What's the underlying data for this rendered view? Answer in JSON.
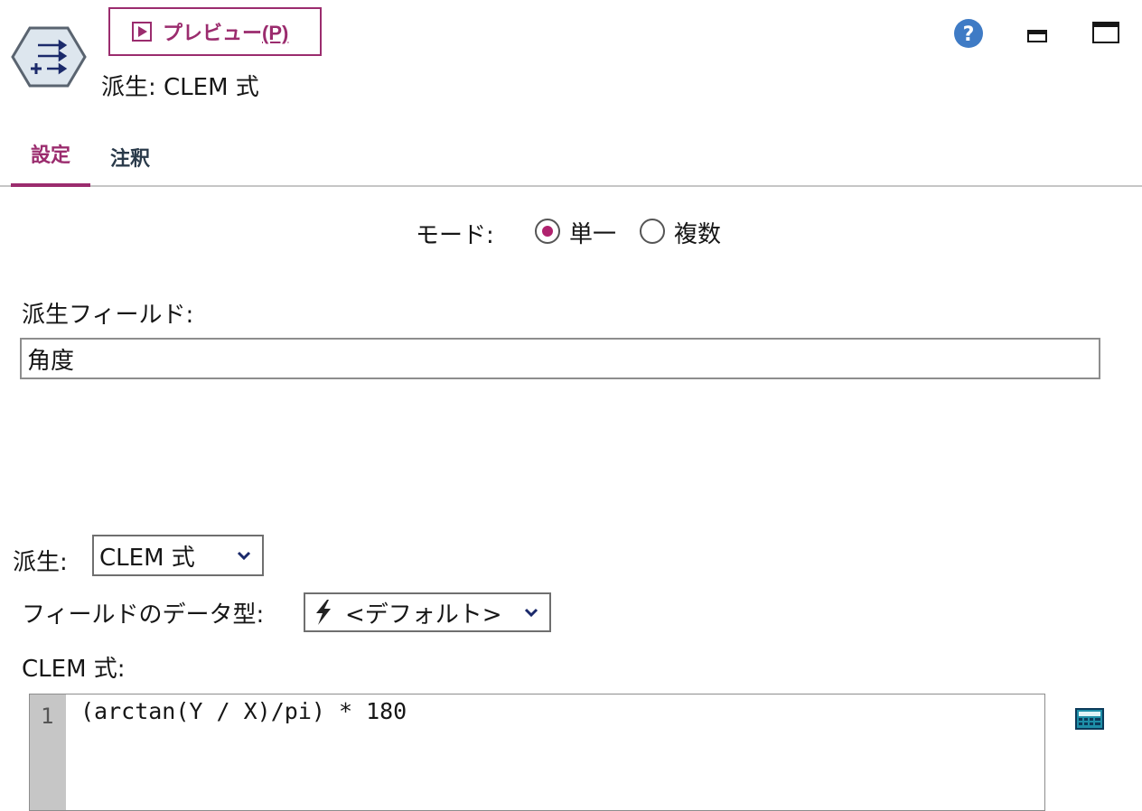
{
  "header": {
    "preview_label": "プレビュー",
    "preview_mnemonic": "(P)",
    "node_title": "派生: CLEM 式"
  },
  "window_icons": [
    "help-icon",
    "minimize-icon",
    "maximize-icon"
  ],
  "tabs": [
    {
      "label": "設定",
      "active": true
    },
    {
      "label": "注釈",
      "active": false
    }
  ],
  "mode": {
    "label": "モード:",
    "options": [
      {
        "label": "単一",
        "selected": true
      },
      {
        "label": "複数",
        "selected": false
      }
    ]
  },
  "derive_field": {
    "label": "派生フィールド:",
    "value": "角度"
  },
  "derive_as": {
    "label": "派生:",
    "selected": "CLEM 式"
  },
  "field_type": {
    "label": "フィールドのデータ型:",
    "selected": "<デフォルト>"
  },
  "clem": {
    "label": "CLEM 式:",
    "line_number": "1",
    "expression": "(arctan(Y / X)/pi) * 180"
  },
  "colors": {
    "accent": "#9b2c6e",
    "radio_selected": "#b0226e",
    "help_blue": "#3f7bc5"
  }
}
